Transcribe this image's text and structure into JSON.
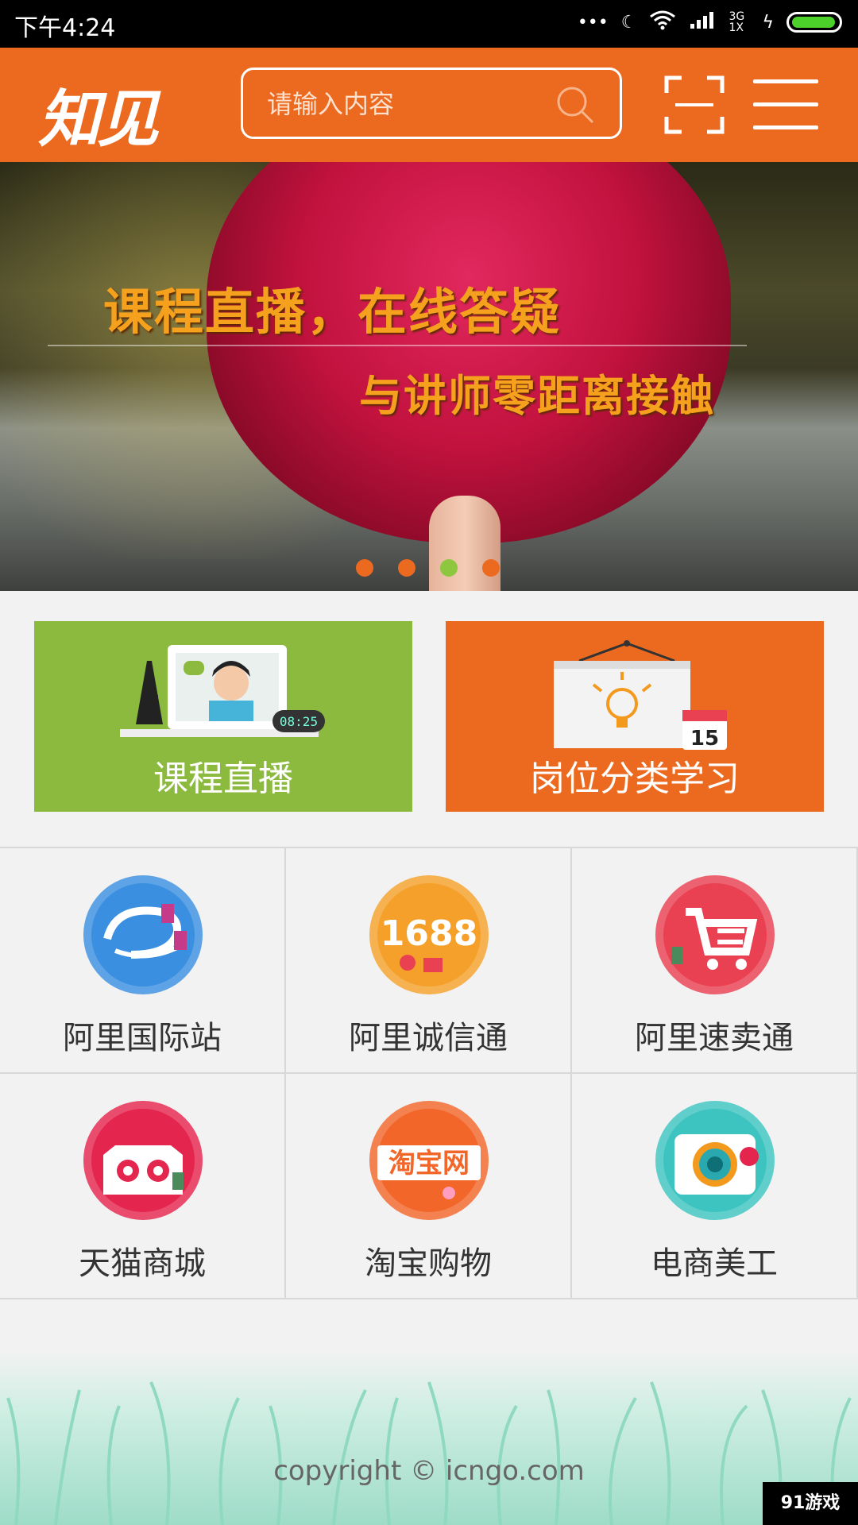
{
  "status_bar": {
    "time": "下午4:24",
    "network": "3G 1X"
  },
  "header": {
    "logo_text": "知见",
    "search_placeholder": "请输入内容",
    "search_icon": "search-icon",
    "scan_icon": "scan-icon",
    "menu_icon": "menu-icon"
  },
  "banner": {
    "line1": "课程直播，在线答疑",
    "line2": "与讲师零距离接触",
    "slides": 4,
    "active_slide": 3
  },
  "tiles": [
    {
      "label": "课程直播",
      "color": "#8cba3f",
      "icon": "live-course-icon"
    },
    {
      "label": "岗位分类学习",
      "color": "#ec6a1f",
      "icon": "calendar-bulb-icon"
    }
  ],
  "grid": [
    {
      "label": "阿里国际站",
      "color": "#3a8fe0",
      "icon": "alibaba-icon"
    },
    {
      "label": "阿里诚信通",
      "color": "#f5a02a",
      "icon": "1688-icon"
    },
    {
      "label": "阿里速卖通",
      "color": "#e94052",
      "icon": "cart-icon"
    },
    {
      "label": "天猫商城",
      "color": "#e4254e",
      "icon": "tmall-icon"
    },
    {
      "label": "淘宝购物",
      "color": "#f2662a",
      "icon": "taobao-icon"
    },
    {
      "label": "电商美工",
      "color": "#3ec4c0",
      "icon": "camera-icon"
    }
  ],
  "grid_text": {
    "1688": "1688",
    "taobao": "淘宝网"
  },
  "footer": {
    "copyright": "copyright © icngo.com",
    "watermark": "91游戏"
  }
}
